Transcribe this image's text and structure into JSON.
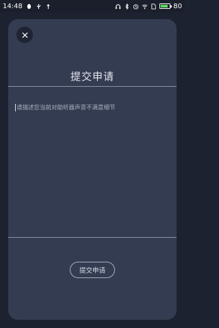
{
  "status_bar": {
    "time": "14:48",
    "battery_level": "80",
    "battery_fraction": 0.8,
    "left_icons": [
      "qq-icon",
      "usb-icon",
      "share-icon",
      "signal-tower-icon"
    ],
    "right_icons": [
      "headphones-icon",
      "bluetooth-icon",
      "alarm-icon",
      "wifi-icon",
      "sim-icon",
      "battery-icon"
    ]
  },
  "dialog": {
    "close_icon": "close-icon",
    "title": "提交申请",
    "textarea_placeholder": "请描述您当前对助听器声音不满意细节",
    "submit_label": "提交申请"
  },
  "colors": {
    "page_background": "#1d2230",
    "card_background": "#343c52",
    "title_text": "#e6e9f0",
    "placeholder_text": "#aab0c0",
    "divider": "#8a93a8"
  }
}
